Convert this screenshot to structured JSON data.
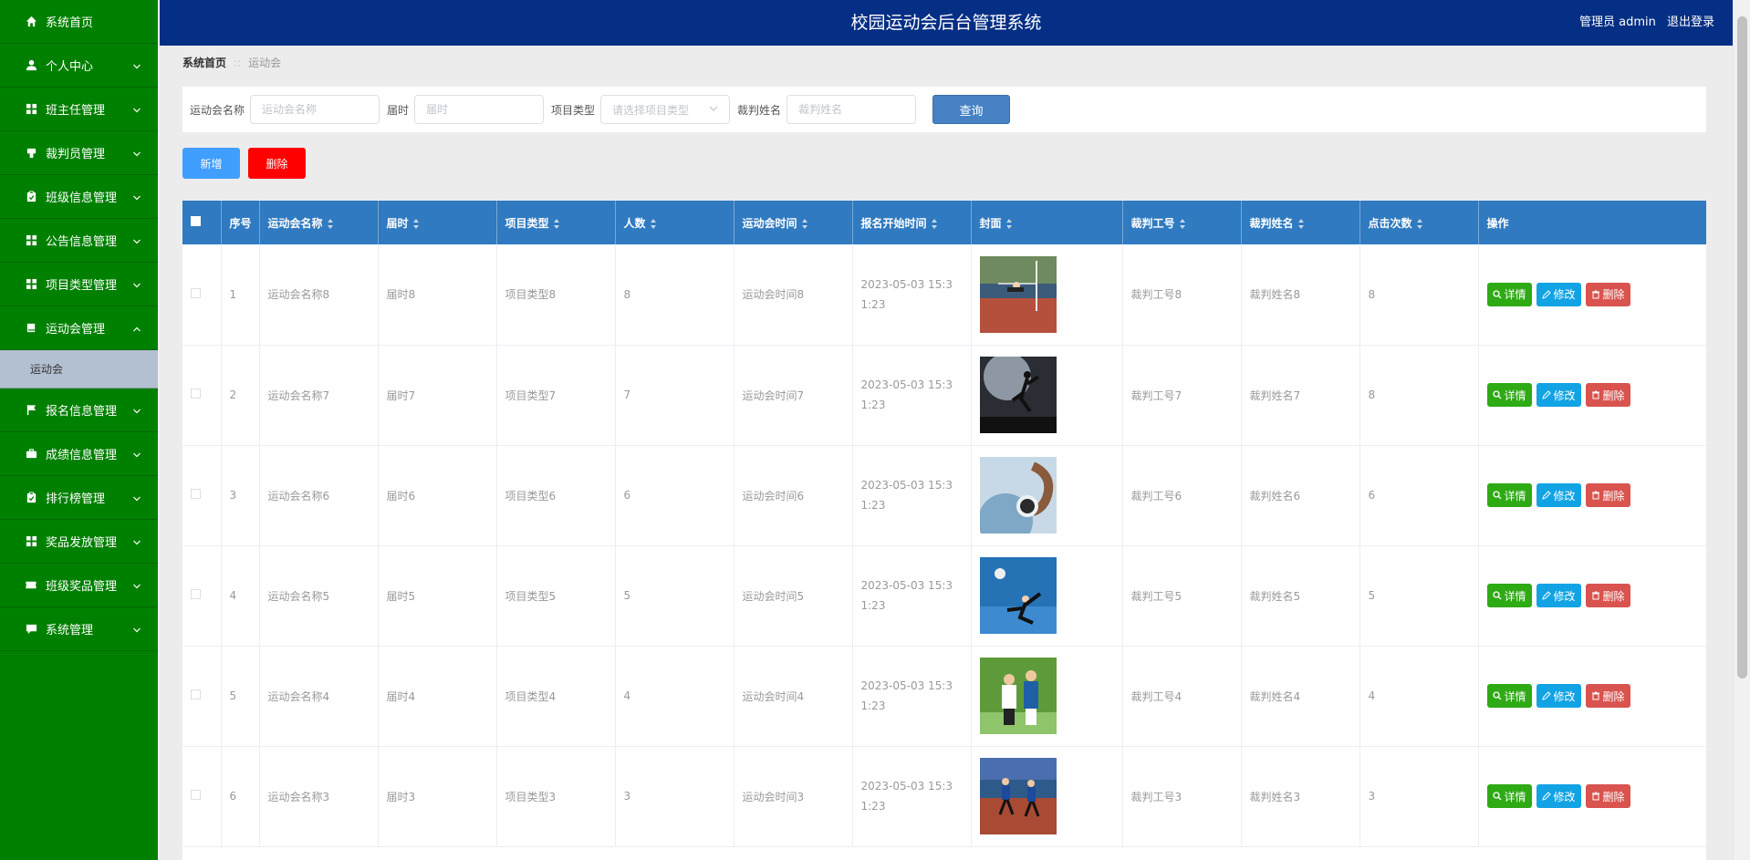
{
  "header": {
    "title": "校园运动会后台管理系统",
    "user_label": "管理员 admin",
    "logout_label": "退出登录"
  },
  "sidebar": {
    "items": [
      {
        "label": "系统首页",
        "icon": "home-icon",
        "has_chevron": false
      },
      {
        "label": "个人中心",
        "icon": "user-icon",
        "has_chevron": true
      },
      {
        "label": "班主任管理",
        "icon": "grid-icon",
        "has_chevron": true
      },
      {
        "label": "裁判员管理",
        "icon": "whistle-icon",
        "has_chevron": true
      },
      {
        "label": "班级信息管理",
        "icon": "clipboard-icon",
        "has_chevron": true
      },
      {
        "label": "公告信息管理",
        "icon": "grid-icon",
        "has_chevron": true
      },
      {
        "label": "项目类型管理",
        "icon": "grid-icon",
        "has_chevron": true
      },
      {
        "label": "运动会管理",
        "icon": "book-icon",
        "has_chevron": true,
        "expanded": true
      },
      {
        "label": "报名信息管理",
        "icon": "flag-icon",
        "has_chevron": true
      },
      {
        "label": "成绩信息管理",
        "icon": "briefcase-icon",
        "has_chevron": true
      },
      {
        "label": "排行榜管理",
        "icon": "clipboard-icon",
        "has_chevron": true
      },
      {
        "label": "奖品发放管理",
        "icon": "grid-icon",
        "has_chevron": true
      },
      {
        "label": "班级奖品管理",
        "icon": "ticket-icon",
        "has_chevron": true
      },
      {
        "label": "系统管理",
        "icon": "chat-icon",
        "has_chevron": true
      }
    ],
    "submenu_active": "运动会"
  },
  "breadcrumb": {
    "home": "系统首页",
    "separator": "::",
    "current": "运动会"
  },
  "search": {
    "name_label": "运动会名称",
    "name_placeholder": "运动会名称",
    "session_label": "届时",
    "session_placeholder": "届时",
    "type_label": "项目类型",
    "type_placeholder": "请选择项目类型",
    "referee_label": "裁判姓名",
    "referee_placeholder": "裁判姓名",
    "query_label": "查询"
  },
  "actions": {
    "add_label": "新增",
    "delete_label": "删除"
  },
  "table": {
    "columns": [
      "序号",
      "运动会名称",
      "届时",
      "项目类型",
      "人数",
      "运动会时间",
      "报名开始时间",
      "封面",
      "裁判工号",
      "裁判姓名",
      "点击次数",
      "操作"
    ],
    "rows": [
      {
        "idx": "1",
        "name": "运动会名称8",
        "session": "届时8",
        "type": "项目类型8",
        "count": "8",
        "time": "运动会时间8",
        "start": "2023-05-03 15:31:23",
        "job": "裁判工号8",
        "referee": "裁判姓名8",
        "clicks": "8"
      },
      {
        "idx": "2",
        "name": "运动会名称7",
        "session": "届时7",
        "type": "项目类型7",
        "count": "7",
        "time": "运动会时间7",
        "start": "2023-05-03 15:31:23",
        "job": "裁判工号7",
        "referee": "裁判姓名7",
        "clicks": "8"
      },
      {
        "idx": "3",
        "name": "运动会名称6",
        "session": "届时6",
        "type": "项目类型6",
        "count": "6",
        "time": "运动会时间6",
        "start": "2023-05-03 15:31:23",
        "job": "裁判工号6",
        "referee": "裁判姓名6",
        "clicks": "6"
      },
      {
        "idx": "4",
        "name": "运动会名称5",
        "session": "届时5",
        "type": "项目类型5",
        "count": "5",
        "time": "运动会时间5",
        "start": "2023-05-03 15:31:23",
        "job": "裁判工号5",
        "referee": "裁判姓名5",
        "clicks": "5"
      },
      {
        "idx": "5",
        "name": "运动会名称4",
        "session": "届时4",
        "type": "项目类型4",
        "count": "4",
        "time": "运动会时间4",
        "start": "2023-05-03 15:31:23",
        "job": "裁判工号4",
        "referee": "裁判姓名4",
        "clicks": "4"
      },
      {
        "idx": "6",
        "name": "运动会名称3",
        "session": "届时3",
        "type": "项目类型3",
        "count": "3",
        "time": "运动会时间3",
        "start": "2023-05-03 15:31:23",
        "job": "裁判工号3",
        "referee": "裁判姓名3",
        "clicks": "3"
      }
    ],
    "op_labels": {
      "detail": "详情",
      "edit": "修改",
      "delete": "删除"
    }
  },
  "colors": {
    "sidebar_bg": "#008000",
    "topbar_bg": "#052f84",
    "table_header_bg": "#2f7ac0",
    "add_button": "#409eff",
    "delete_button": "#ff0000",
    "query_button": "#4682c4",
    "detail_button": "#2eaa15",
    "edit_button": "#12a3e4",
    "row_delete_button": "#d9534f"
  }
}
